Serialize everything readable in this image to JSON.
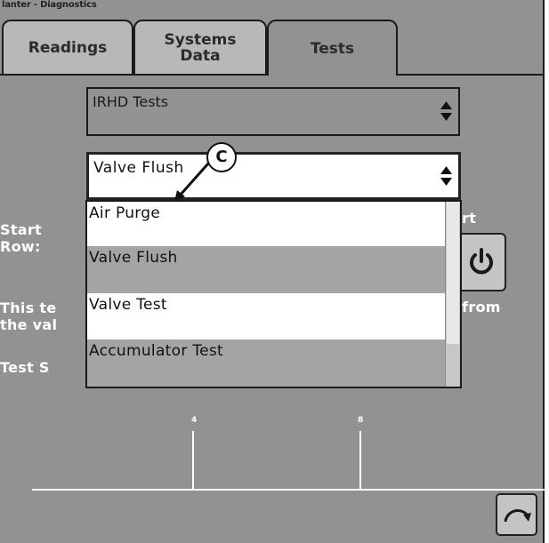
{
  "window": {
    "title": "lanter - Diagnostics"
  },
  "tabs": [
    {
      "label": "Readings",
      "active": false
    },
    {
      "label": "Systems Data",
      "active": false
    },
    {
      "label": "Tests",
      "active": true
    }
  ],
  "tests": {
    "type_select": {
      "value": "IRHD Tests",
      "icon": "up-down-spinner-icon"
    },
    "test_select": {
      "value": "Valve Flush",
      "icon": "up-down-spinner-icon"
    },
    "dropdown_options": [
      "Air Purge",
      "Valve Flush",
      "Valve Test",
      "Accumulator Test"
    ],
    "start_row_label": "Start Row:",
    "description_left": "This te the val",
    "description_right": "from",
    "start_label_right": "rt",
    "test_status_label": "Test S",
    "start_button_icon": "power-icon"
  },
  "chart": {
    "tick_labels": [
      "4",
      "8"
    ]
  },
  "callout": {
    "label": "C"
  },
  "refresh_button_icon": "refresh-icon",
  "colors": {
    "panel": "#929292",
    "inactive_tab": "#b8b8b8",
    "dropdown_grey": "#a4a4a4",
    "text_light": "#ffffff"
  }
}
